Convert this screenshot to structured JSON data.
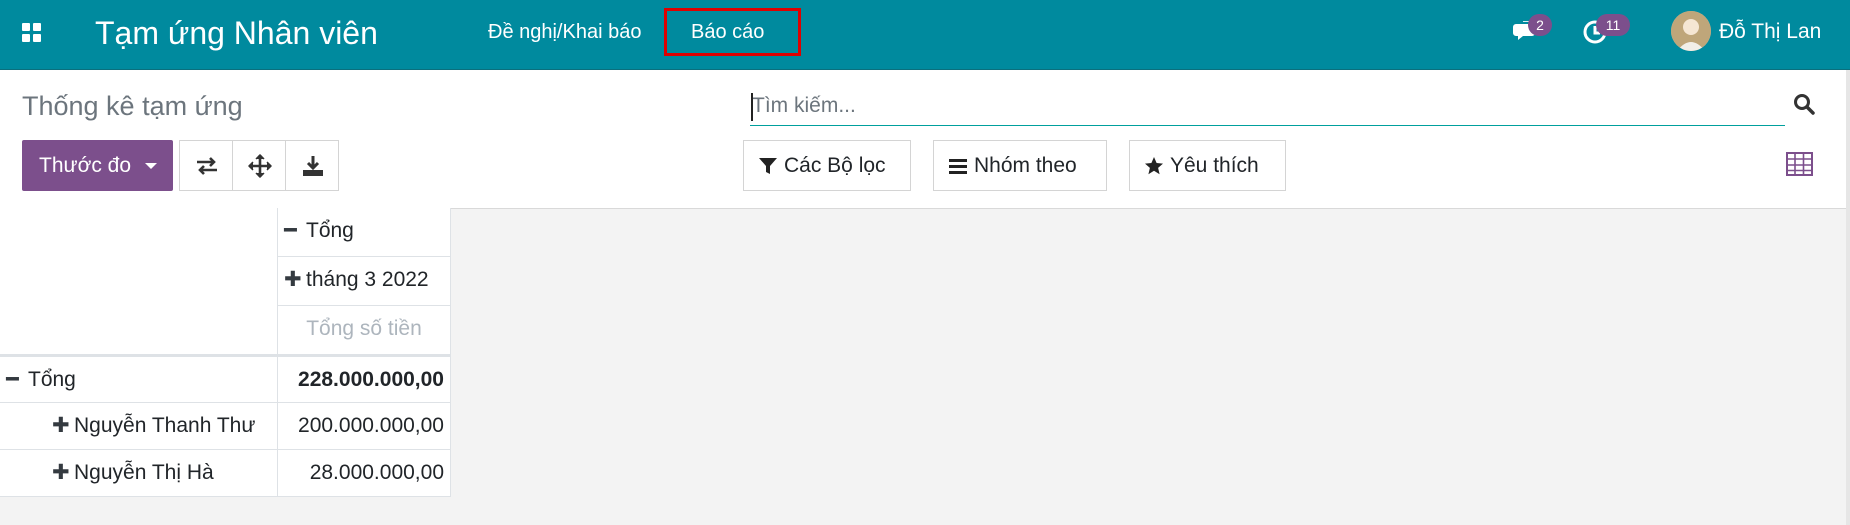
{
  "navbar": {
    "app_title": "Tạm ứng Nhân viên",
    "menu": [
      "Đề nghị/Khai báo",
      "Báo cáo"
    ],
    "messages_count": "2",
    "activities_count": "11",
    "user_name": "Đỗ Thị Lan",
    "bg_color": "#008a9e",
    "highlight_color": "#e00000"
  },
  "control_panel": {
    "title": "Thống kê tạm ứng",
    "search_placeholder": "Tìm kiếm...",
    "measure_label": "Thước đo",
    "filters_label": "Các Bộ lọc",
    "groupby_label": "Nhóm theo",
    "favorites_label": "Yêu thích",
    "tool_icons": [
      "swap-axes-icon",
      "expand-all-icon",
      "download-icon"
    ],
    "accent_color": "#7c4f8c"
  },
  "pivot": {
    "col_header_total": "Tổng",
    "col_header_period": "tháng 3 2022",
    "measure_header": "Tổng số tiền",
    "row_total_label": "Tổng",
    "row_total_value": "228.000.000,00",
    "rows": [
      {
        "label": "Nguyễn Thanh Thư",
        "value": "200.000.000,00"
      },
      {
        "label": "Nguyễn Thị Hà",
        "value": "28.000.000,00"
      }
    ]
  }
}
